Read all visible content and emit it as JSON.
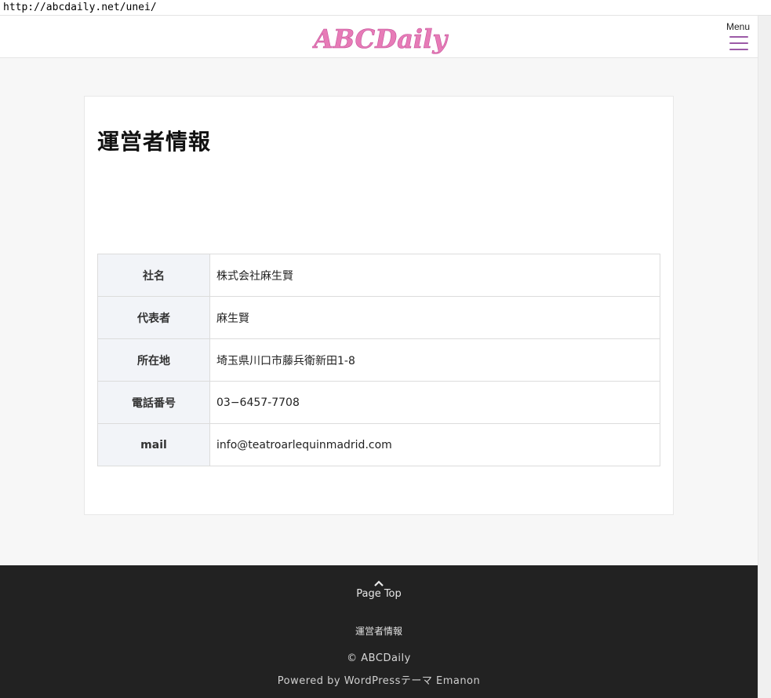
{
  "browser": {
    "url": "http://abcdaily.net/unei/"
  },
  "header": {
    "logo_text": "ABCDaily",
    "menu_label": "Menu"
  },
  "colors": {
    "logo_pink": "#e77bb7",
    "menu_purple": "#9c5aa7",
    "footer_bg": "#222222"
  },
  "page": {
    "title": "運営者情報",
    "table": [
      {
        "label": "社名",
        "value": "株式会社麻生賢"
      },
      {
        "label": "代表者",
        "value": "麻生賢"
      },
      {
        "label": "所在地",
        "value": "埼玉県川口市藤兵衛新田1-8"
      },
      {
        "label": "電話番号",
        "value": "03−6457-7708"
      },
      {
        "label": "mail",
        "value": "info@teatroarlequinmadrid.com"
      }
    ]
  },
  "footer": {
    "page_top_label": "Page Top",
    "link_label": "運営者情報",
    "copyright": "© ABCDaily",
    "powered": "Powered by WordPressテーマ Emanon"
  },
  "icons": {
    "menu": "hamburger-icon",
    "page_top": "chevron-up-icon"
  }
}
